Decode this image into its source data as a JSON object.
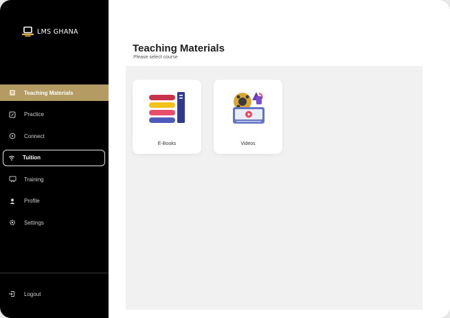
{
  "brand": {
    "name": "LMS GHANA"
  },
  "sidebar": {
    "items": [
      {
        "label": "Teaching Materials",
        "icon": "book-icon",
        "state": "active"
      },
      {
        "label": "Practice",
        "icon": "edit-icon",
        "state": "normal"
      },
      {
        "label": "Connect",
        "icon": "play-circle-icon",
        "state": "normal"
      },
      {
        "label": "Tuition",
        "icon": "wifi-icon",
        "state": "outlined"
      },
      {
        "label": "Training",
        "icon": "presentation-icon",
        "state": "normal"
      },
      {
        "label": "Profile",
        "icon": "user-icon",
        "state": "normal"
      },
      {
        "label": "Settings",
        "icon": "gear-icon",
        "state": "normal"
      }
    ],
    "logout_label": "Logout"
  },
  "main": {
    "title": "Teaching Materials",
    "subtitle": "Please select course",
    "cards": [
      {
        "label": "E-Books",
        "icon": "ebooks-icon"
      },
      {
        "label": "Videos",
        "icon": "videos-icon"
      }
    ]
  },
  "colors": {
    "sidebar_bg": "#000000",
    "active_item_bg": "#b49a63",
    "panel_bg": "#f1f1f1"
  }
}
